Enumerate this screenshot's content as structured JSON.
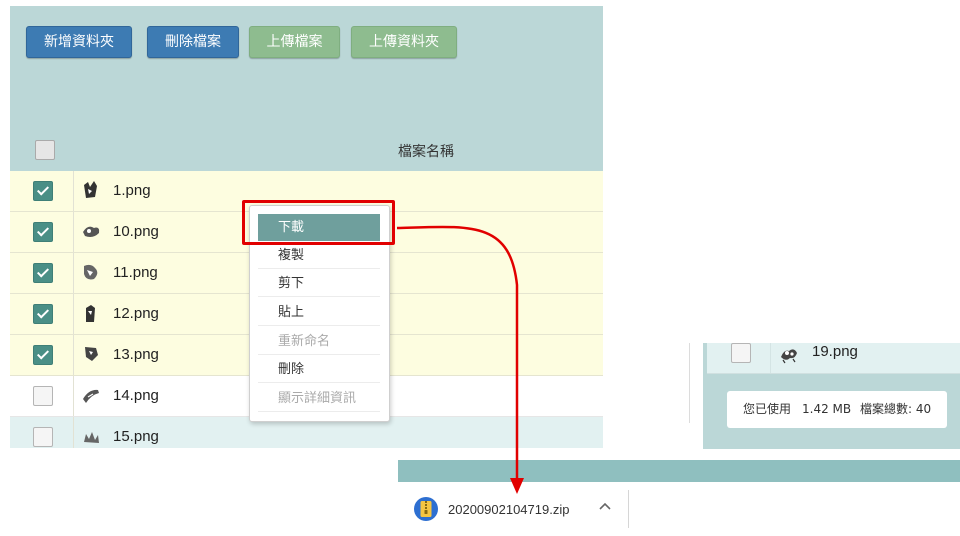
{
  "toolbar": {
    "new_folder": "新增資料夾",
    "delete_file": "刪除檔案",
    "upload_file": "上傳檔案",
    "upload_folder": "上傳資料夾"
  },
  "table": {
    "header_name": "檔案名稱",
    "rows": [
      {
        "name": "1.png",
        "checked": true
      },
      {
        "name": "10.png",
        "checked": true
      },
      {
        "name": "11.png",
        "checked": true
      },
      {
        "name": "12.png",
        "checked": true
      },
      {
        "name": "13.png",
        "checked": true
      },
      {
        "name": "14.png",
        "checked": false
      },
      {
        "name": "15.png",
        "checked": false
      }
    ]
  },
  "context_menu": {
    "items": [
      {
        "label": "下載",
        "state": "active"
      },
      {
        "label": "複製",
        "state": "enabled"
      },
      {
        "label": "剪下",
        "state": "enabled"
      },
      {
        "label": "貼上",
        "state": "enabled"
      },
      {
        "label": "重新命名",
        "state": "disabled"
      },
      {
        "label": "刪除",
        "state": "enabled"
      },
      {
        "label": "顯示詳細資訊",
        "state": "disabled"
      }
    ]
  },
  "right_panel": {
    "row_name": "19.png",
    "usage_label": "您已使用",
    "usage_value": "1.42 MB",
    "count_label": "檔案總數: 40"
  },
  "download_bar": {
    "file_name": "20200902104719.zip"
  },
  "colors": {
    "panel_bg": "#bbd7d7",
    "blue_button": "#3d7bb3",
    "green_button": "#8ebc8f",
    "checkbox_checked": "#4a8f86",
    "selected_row": "#fdfde0",
    "menu_active": "#6f9f9d",
    "highlight": "#e10000"
  }
}
